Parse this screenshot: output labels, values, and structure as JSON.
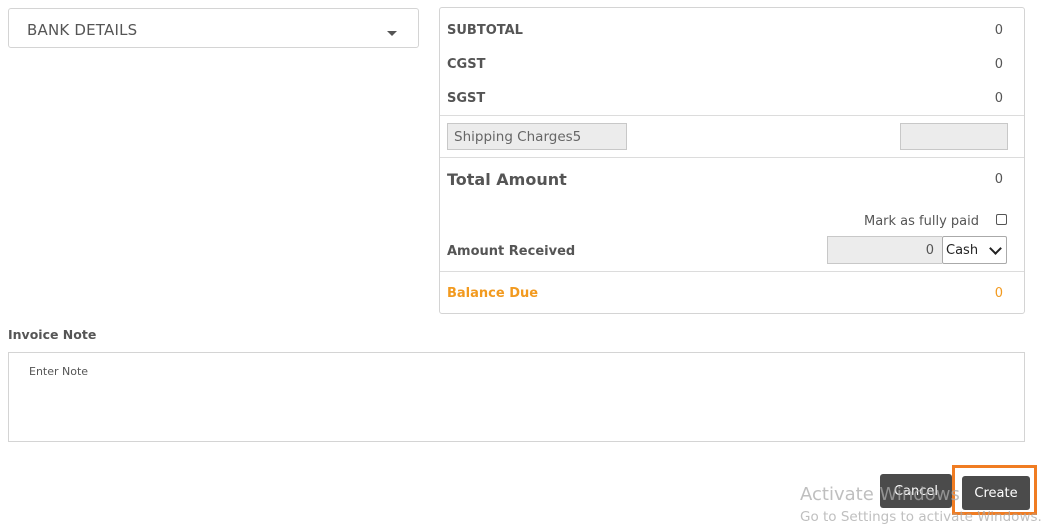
{
  "bank": {
    "label": "BANK DETAILS"
  },
  "summary": {
    "subtotal": {
      "label": "SUBTOTAL",
      "value": "0"
    },
    "cgst": {
      "label": "CGST",
      "value": "0"
    },
    "sgst": {
      "label": "SGST",
      "value": "0"
    },
    "shipping": {
      "name": "Shipping Charges5",
      "value": ""
    },
    "total": {
      "label": "Total Amount",
      "value": "0"
    },
    "mark_paid": {
      "label": "Mark as fully paid",
      "checked": false
    },
    "received": {
      "label": "Amount Received",
      "value": "0",
      "method": "Cash"
    },
    "balance": {
      "label": "Balance Due",
      "value": "0",
      "color": "#f29a1f"
    }
  },
  "note": {
    "label": "Invoice Note",
    "placeholder": "Enter Note"
  },
  "buttons": {
    "cancel": "Cancel",
    "create": "Create",
    "highlight": "#f07c22"
  },
  "watermark": {
    "line1": "Activate Windows",
    "line2": "Go to Settings to activate Windows."
  }
}
